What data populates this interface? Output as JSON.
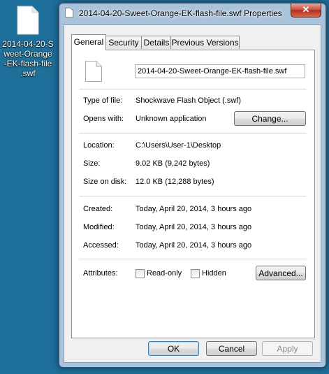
{
  "desktop": {
    "icon_label": "2014-04-20-Sweet-Orange-EK-flash-file.swf",
    "icon_label_lines": [
      "2014-04-20-S",
      "weet-Orange",
      "-EK-flash-file",
      ".swf"
    ],
    "icon": "blank-file-icon"
  },
  "window": {
    "title": "2014-04-20-Sweet-Orange-EK-flash-file.swf Properties",
    "close_label": "✕",
    "title_icon": "file-icon"
  },
  "tabs": [
    {
      "label": "General",
      "active": true
    },
    {
      "label": "Security",
      "active": false
    },
    {
      "label": "Details",
      "active": false
    },
    {
      "label": "Previous Versions",
      "active": false
    }
  ],
  "general": {
    "file_name": "2014-04-20-Sweet-Orange-EK-flash-file.swf",
    "type_label": "Type of file:",
    "type_value": "Shockwave Flash Object (.swf)",
    "opens_label": "Opens with:",
    "opens_value": "Unknown application",
    "change_button": "Change...",
    "location_label": "Location:",
    "location_value": "C:\\Users\\User-1\\Desktop",
    "size_label": "Size:",
    "size_value": "9.02 KB (9,242 bytes)",
    "size_on_disk_label": "Size on disk:",
    "size_on_disk_value": "12.0 KB (12,288 bytes)",
    "created_label": "Created:",
    "created_value": "Today, April 20, 2014, 3 hours ago",
    "modified_label": "Modified:",
    "modified_value": "Today, April 20, 2014, 3 hours ago",
    "accessed_label": "Accessed:",
    "accessed_value": "Today, April 20, 2014, 3 hours ago",
    "attributes_label": "Attributes:",
    "readonly_label": "Read-only",
    "readonly_checked": false,
    "hidden_label": "Hidden",
    "hidden_checked": false,
    "advanced_button": "Advanced..."
  },
  "footer": {
    "ok": "OK",
    "cancel": "Cancel",
    "apply": "Apply"
  },
  "colors": {
    "desktop": "#1e6f9a",
    "window_frame": "#a9c3dc",
    "close_button": "#c7493a"
  }
}
